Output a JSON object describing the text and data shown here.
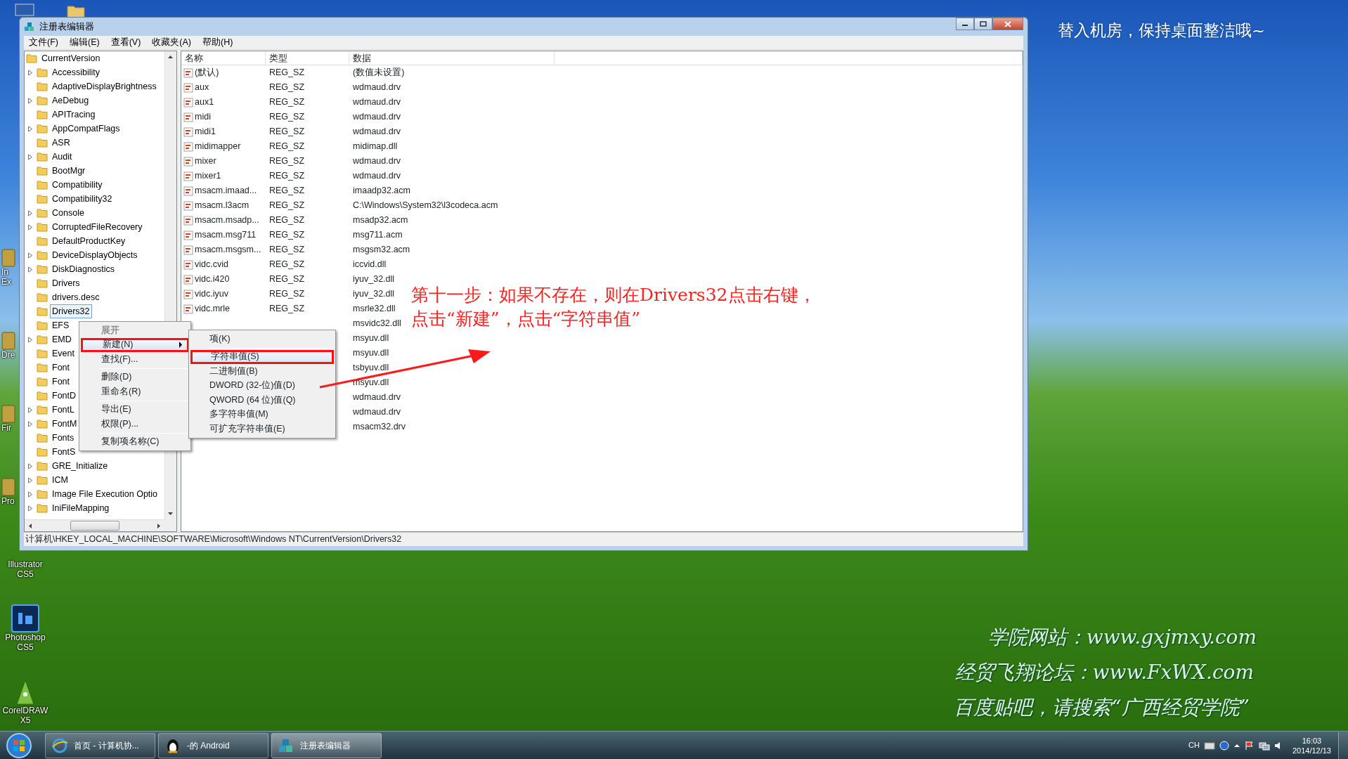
{
  "desktop_icons": [
    {
      "label": "In Ex",
      "kind": "edge"
    },
    {
      "label": "Dre",
      "kind": "edge"
    },
    {
      "label": "Fir",
      "kind": "edge"
    },
    {
      "label": "Pro",
      "kind": "edge"
    },
    {
      "label": "Illustrator CS5",
      "kind": "label_only"
    },
    {
      "label": "Photoshop CS5",
      "kind": "photoshop"
    },
    {
      "label": "CorelDRAW X5",
      "kind": "corel"
    }
  ],
  "wallpaper_text": {
    "top": "替入机房，保持桌面整洁哦~",
    "lines": [
      "学院网站：www.gxjmxy.com",
      "经贸飞翔论坛：www.FxWX.com",
      "百度贴吧，请搜索“广西经贸学院”"
    ]
  },
  "window": {
    "title": "注册表编辑器",
    "menu": [
      "文件(F)",
      "编辑(E)",
      "查看(V)",
      "收藏夹(A)",
      "帮助(H)"
    ],
    "tree": {
      "label": "CurrentVersion",
      "children": [
        {
          "label": "Accessibility",
          "expandable": true,
          "selected": false
        },
        {
          "label": "AdaptiveDisplayBrightness",
          "expandable": false,
          "selected": false
        },
        {
          "label": "AeDebug",
          "expandable": true,
          "selected": false
        },
        {
          "label": "APITracing",
          "expandable": false,
          "selected": false
        },
        {
          "label": "AppCompatFlags",
          "expandable": true,
          "selected": false
        },
        {
          "label": "ASR",
          "expandable": false,
          "selected": false
        },
        {
          "label": "Audit",
          "expandable": true,
          "selected": false
        },
        {
          "label": "BootMgr",
          "expandable": false,
          "selected": false
        },
        {
          "label": "Compatibility",
          "expandable": false,
          "selected": false
        },
        {
          "label": "Compatibility32",
          "expandable": false,
          "selected": false
        },
        {
          "label": "Console",
          "expandable": true,
          "selected": false
        },
        {
          "label": "CorruptedFileRecovery",
          "expandable": true,
          "selected": false
        },
        {
          "label": "DefaultProductKey",
          "expandable": false,
          "selected": false
        },
        {
          "label": "DeviceDisplayObjects",
          "expandable": true,
          "selected": false
        },
        {
          "label": "DiskDiagnostics",
          "expandable": true,
          "selected": false
        },
        {
          "label": "Drivers",
          "expandable": false,
          "selected": false
        },
        {
          "label": "drivers.desc",
          "expandable": false,
          "selected": false
        },
        {
          "label": "Drivers32",
          "expandable": false,
          "selected": true
        },
        {
          "label": "EFS",
          "expandable": false,
          "selected": false
        },
        {
          "label": "EMD",
          "expandable": true,
          "selected": false
        },
        {
          "label": "Event",
          "expandable": false,
          "selected": false
        },
        {
          "label": "Font",
          "expandable": false,
          "selected": false
        },
        {
          "label": "Font",
          "expandable": false,
          "selected": false
        },
        {
          "label": "FontD",
          "expandable": false,
          "selected": false
        },
        {
          "label": "FontL",
          "expandable": true,
          "selected": false
        },
        {
          "label": "FontM",
          "expandable": true,
          "selected": false
        },
        {
          "label": "Fonts",
          "expandable": false,
          "selected": false
        },
        {
          "label": "FontS",
          "expandable": false,
          "selected": false
        },
        {
          "label": "GRE_Initialize",
          "expandable": true,
          "selected": false
        },
        {
          "label": "ICM",
          "expandable": true,
          "selected": false
        },
        {
          "label": "Image File Execution Optio",
          "expandable": true,
          "selected": false
        },
        {
          "label": "IniFileMapping",
          "expandable": true,
          "selected": false
        }
      ]
    },
    "table": {
      "columns": [
        "名称",
        "类型",
        "数据"
      ],
      "rows": [
        {
          "name": "(默认)",
          "type": "REG_SZ",
          "data": "(数值未设置)"
        },
        {
          "name": "aux",
          "type": "REG_SZ",
          "data": "wdmaud.drv"
        },
        {
          "name": "aux1",
          "type": "REG_SZ",
          "data": "wdmaud.drv"
        },
        {
          "name": "midi",
          "type": "REG_SZ",
          "data": "wdmaud.drv"
        },
        {
          "name": "midi1",
          "type": "REG_SZ",
          "data": "wdmaud.drv"
        },
        {
          "name": "midimapper",
          "type": "REG_SZ",
          "data": "midimap.dll"
        },
        {
          "name": "mixer",
          "type": "REG_SZ",
          "data": "wdmaud.drv"
        },
        {
          "name": "mixer1",
          "type": "REG_SZ",
          "data": "wdmaud.drv"
        },
        {
          "name": "msacm.imaad...",
          "type": "REG_SZ",
          "data": "imaadp32.acm"
        },
        {
          "name": "msacm.l3acm",
          "type": "REG_SZ",
          "data": "C:\\Windows\\System32\\l3codeca.acm"
        },
        {
          "name": "msacm.msadp...",
          "type": "REG_SZ",
          "data": "msadp32.acm"
        },
        {
          "name": "msacm.msg711",
          "type": "REG_SZ",
          "data": "msg711.acm"
        },
        {
          "name": "msacm.msgsm...",
          "type": "REG_SZ",
          "data": "msgsm32.acm"
        },
        {
          "name": "vidc.cvid",
          "type": "REG_SZ",
          "data": "iccvid.dll"
        },
        {
          "name": "vidc.i420",
          "type": "REG_SZ",
          "data": "iyuv_32.dll"
        },
        {
          "name": "vidc.iyuv",
          "type": "REG_SZ",
          "data": "iyuv_32.dll"
        },
        {
          "name": "vidc.mrle",
          "type": "REG_SZ",
          "data": "msrle32.dll"
        },
        {
          "data": "msvidc32.dll"
        },
        {
          "data": "msyuv.dll"
        },
        {
          "data": "msyuv.dll"
        },
        {
          "data": "tsbyuv.dll"
        },
        {
          "data": "msyuv.dll"
        },
        {
          "data": "wdmaud.drv"
        },
        {
          "data": "wdmaud.drv"
        },
        {
          "data": "msacm32.drv"
        }
      ]
    },
    "status_bar": "计算机\\HKEY_LOCAL_MACHINE\\SOFTWARE\\Microsoft\\Windows NT\\CurrentVersion\\Drivers32",
    "context_menu": [
      {
        "kind": "item",
        "label": "展开",
        "disabled": true,
        "default": true,
        "selected": false,
        "has_submenu": false,
        "annotated": false
      },
      {
        "kind": "item",
        "label": "新建(N)",
        "disabled": false,
        "default": false,
        "selected": true,
        "has_submenu": true,
        "annotated": true
      },
      {
        "kind": "item",
        "label": "查找(F)...",
        "disabled": false,
        "default": false,
        "selected": false,
        "has_submenu": false,
        "annotated": false
      },
      {
        "kind": "separator"
      },
      {
        "kind": "item",
        "label": "删除(D)",
        "disabled": false,
        "default": false,
        "selected": false,
        "has_submenu": false,
        "annotated": false
      },
      {
        "kind": "item",
        "label": "重命名(R)",
        "disabled": false,
        "default": false,
        "selected": false,
        "has_submenu": false,
        "annotated": false
      },
      {
        "kind": "separator"
      },
      {
        "kind": "item",
        "label": "导出(E)",
        "disabled": false,
        "default": false,
        "selected": false,
        "has_submenu": false,
        "annotated": false
      },
      {
        "kind": "item",
        "label": "权限(P)...",
        "disabled": false,
        "default": false,
        "selected": false,
        "has_submenu": false,
        "annotated": false
      },
      {
        "kind": "separator"
      },
      {
        "kind": "item",
        "label": "复制项名称(C)",
        "disabled": false,
        "default": false,
        "selected": false,
        "has_submenu": false,
        "annotated": false
      }
    ],
    "submenu": [
      {
        "kind": "item",
        "label": "项(K)",
        "selected": false,
        "annotated": false
      },
      {
        "kind": "separator"
      },
      {
        "kind": "item",
        "label": "字符串值(S)",
        "selected": true,
        "annotated": true
      },
      {
        "kind": "item",
        "label": "二进制值(B)",
        "selected": false,
        "annotated": false
      },
      {
        "kind": "item",
        "label": "DWORD (32-位)值(D)",
        "selected": false,
        "annotated": false
      },
      {
        "kind": "item",
        "label": "QWORD (64 位)值(Q)",
        "selected": false,
        "annotated": false
      },
      {
        "kind": "item",
        "label": "多字符串值(M)",
        "selected": false,
        "annotated": false
      },
      {
        "kind": "item",
        "label": "可扩充字符串值(E)",
        "selected": false,
        "annotated": false
      }
    ]
  },
  "annotation": {
    "lines": [
      "第十一步：如果不存在，则在Drivers32点击右键，",
      "点击“新建”，点击“字符串值”"
    ]
  },
  "taskbar": {
    "buttons": [
      {
        "label": "首页 - 计算机协...",
        "kind": "browser",
        "selected": false
      },
      {
        "label": "-的 Android",
        "kind": "chat",
        "selected": false
      },
      {
        "label": "注册表编辑器",
        "kind": "regedit",
        "selected": true
      }
    ],
    "language": "CH",
    "time": "16:03",
    "date": "2014/12/13"
  }
}
